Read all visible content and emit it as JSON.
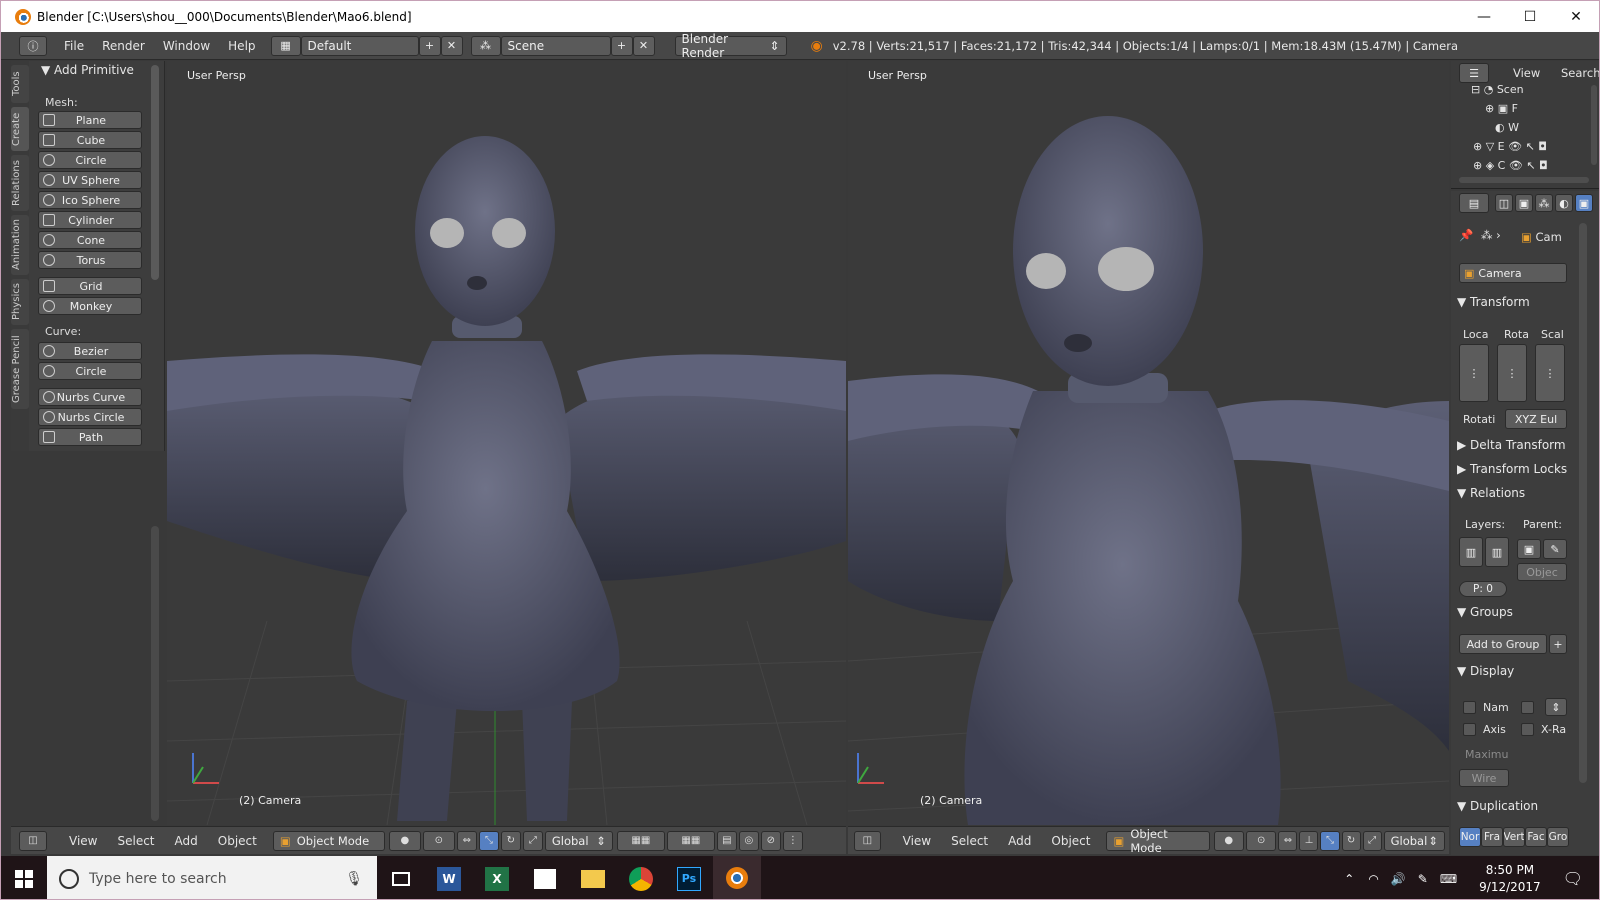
{
  "window": {
    "title": "Blender [C:\\Users\\shou__000\\Documents\\Blender\\Mao6.blend]",
    "controls": {
      "minimize": "—",
      "maximize": "☐",
      "close": "✕"
    }
  },
  "info_header": {
    "menus": [
      "File",
      "Render",
      "Window",
      "Help"
    ],
    "layout": "Default",
    "scene": "Scene",
    "engine": "Blender Render",
    "stats": "v2.78 | Verts:21,517 | Faces:21,172 | Tris:42,344 | Objects:1/4 | Lamps:0/1 | Mem:18.43M (15.47M) | Camera"
  },
  "tool_shelf": {
    "tabs": [
      "Tools",
      "Create",
      "Relations",
      "Animation",
      "Physics",
      "Grease Pencil"
    ],
    "panel_title": "Add Primitive",
    "mesh_label": "Mesh:",
    "mesh_items": [
      "Plane",
      "Cube",
      "Circle",
      "UV Sphere",
      "Ico Sphere",
      "Cylinder",
      "Cone",
      "Torus"
    ],
    "extra_items": [
      "Grid",
      "Monkey"
    ],
    "curve_label": "Curve:",
    "curve_items": [
      "Bezier",
      "Circle"
    ],
    "nurbs_items": [
      "Nurbs Curve",
      "Nurbs Circle",
      "Path"
    ]
  },
  "viewport_left": {
    "persp": "User Persp",
    "object_label": "(2) Camera"
  },
  "viewport_right": {
    "persp": "User Persp",
    "object_label": "(2) Camera"
  },
  "view_header": {
    "menus": [
      "View",
      "Select",
      "Add",
      "Object"
    ],
    "mode": "Object Mode",
    "orientation": "Global"
  },
  "outliner": {
    "menus": [
      "View",
      "Search"
    ],
    "items": [
      "Scen",
      "F",
      "W",
      "E",
      "C"
    ]
  },
  "properties": {
    "breadcrumb": "Cam",
    "object_name": "Camera",
    "transform": {
      "title": "Transform",
      "columns": [
        "Loca",
        "Rota",
        "Scal"
      ],
      "rotation_label": "Rotati",
      "rotation_mode": "XYZ Eul"
    },
    "collapsed": [
      "Delta Transform",
      "Transform Locks"
    ],
    "relations": {
      "title": "Relations",
      "layers_label": "Layers:",
      "parent_label": "Parent:",
      "parent_type": "Objec",
      "pass_index": "P: 0"
    },
    "groups": {
      "title": "Groups",
      "add_label": "Add to Group"
    },
    "display": {
      "title": "Display",
      "name_label": "Nam",
      "axis_label": "Axis",
      "xray_label": "X-Ra",
      "max_label": "Maximu",
      "max_value": "Wire"
    },
    "duplication": {
      "title": "Duplication",
      "options": [
        "Nor",
        "Fra",
        "Vert",
        "Fac",
        "Gro"
      ]
    }
  },
  "taskbar": {
    "search_placeholder": "Type here to search",
    "time": "8:50 PM",
    "date": "9/12/2017"
  }
}
